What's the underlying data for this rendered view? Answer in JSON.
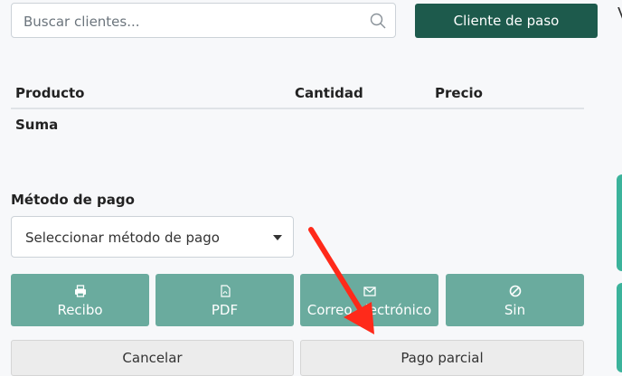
{
  "search": {
    "placeholder": "Buscar clientes..."
  },
  "walkin_button": "Cliente de paso",
  "right_strip_char": "V",
  "table": {
    "headers": [
      "Producto",
      "Cantidad",
      "Precio"
    ],
    "sum_label": "Suma"
  },
  "payment": {
    "label": "Método de pago",
    "select_value": "Seleccionar método de pago"
  },
  "receipt_buttons": [
    {
      "label": "Recibo",
      "icon": "printer-icon"
    },
    {
      "label": "PDF",
      "icon": "pdf-file-icon"
    },
    {
      "label": "Correo electrónico",
      "icon": "envelope-icon"
    },
    {
      "label": "Sin",
      "icon": "ban-icon"
    }
  ],
  "actions": {
    "cancel": "Cancelar",
    "partial": "Pago parcial"
  },
  "colors": {
    "primary": "#1d5a4c",
    "teal": "#6aab9e",
    "accent_strip": "#3bb39b",
    "annotation_arrow": "#ff2a1a"
  }
}
